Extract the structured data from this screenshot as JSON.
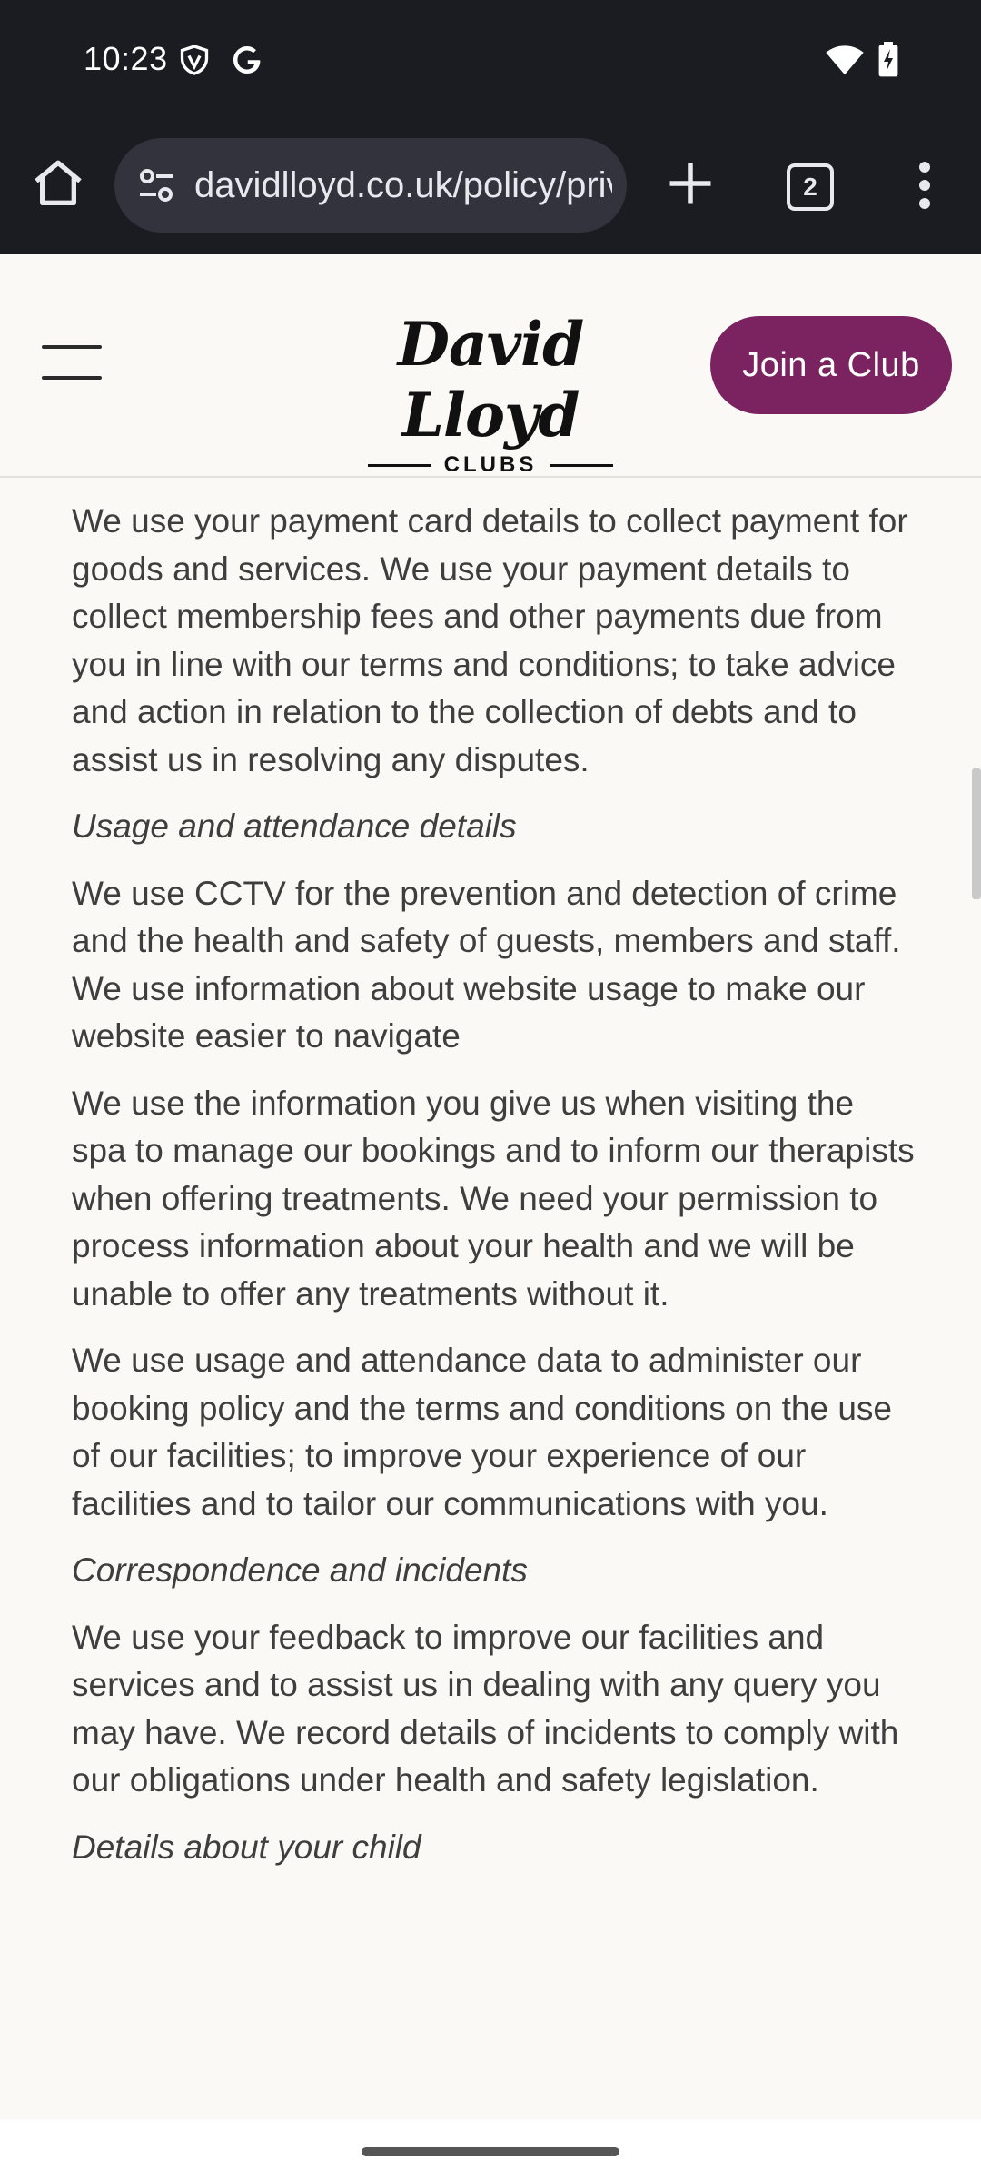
{
  "status_bar": {
    "time": "10:23",
    "icons": [
      "shield-icon",
      "google-icon",
      "wifi-icon",
      "battery-charging-icon"
    ]
  },
  "browser": {
    "url": "davidlloyd.co.uk/policy/privacy",
    "open_tabs": "2",
    "icons": [
      "home-icon",
      "site-settings-icon",
      "new-tab-icon",
      "tab-switcher-icon",
      "more-menu-icon"
    ]
  },
  "header": {
    "logo_word": "David Lloyd",
    "logo_sub": "CLUBS",
    "join_button": "Join a Club"
  },
  "content": {
    "para_payment": "We use your payment card details to collect payment for goods and services. We use your payment details to collect membership fees and other payments due from you in line with our terms and conditions; to take advice and action in relation to the collection of debts and to assist us in resolving any disputes.",
    "heading_usage": "Usage and attendance details",
    "para_cctv": "We use CCTV for the prevention and detection of crime and the health and safety of guests, members and staff. We use information about website usage to make our website easier to navigate",
    "para_spa": "We use the information you give us when visiting the spa to manage our bookings and to inform our therapists when offering treatments. We need your permission to process information about your health and we will be unable to offer any treatments without it.",
    "para_attendance": "We use usage and attendance data to administer our booking policy and the terms and conditions on the use of our facilities; to improve your experience of our facilities and to tailor our communications with you.",
    "heading_correspondence": "Correspondence and incidents",
    "para_feedback": "We use your feedback to improve our facilities and services and to assist us in dealing with any query you may have. We record details of incidents to comply with our obligations under health and safety legislation.",
    "heading_child": "Details about your child"
  },
  "colors": {
    "brand_purple": "#7a2360",
    "page_background": "#faf9f5",
    "browser_chrome": "#1b1b22",
    "body_text": "#3e3e3e"
  }
}
